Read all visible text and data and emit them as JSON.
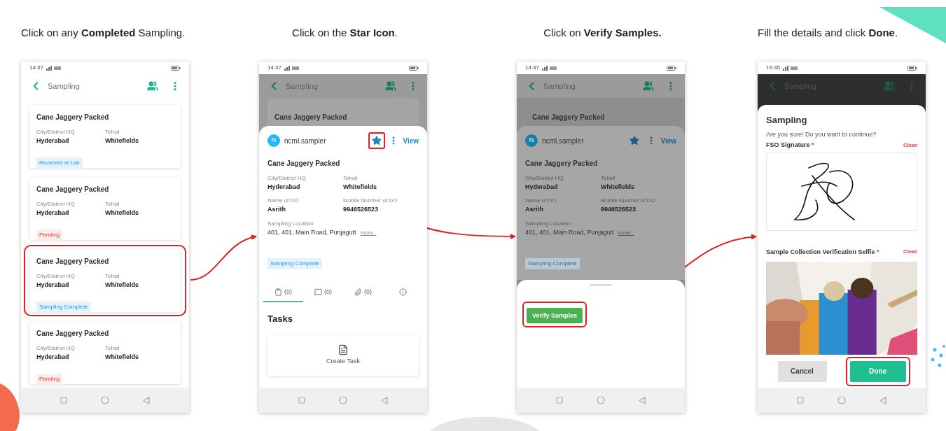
{
  "steps": [
    {
      "instruction": "Click on any **Completed** Sampling.",
      "screen": {
        "kind": "list",
        "time": "14:37",
        "app_title": "Sampling",
        "cards": [
          {
            "title": "Cane Jaggery Packed",
            "fields": [
              {
                "label": "City/District HQ",
                "value": "Hyderabad"
              },
              {
                "label": "Tehsil",
                "value": "Whitefields"
              }
            ],
            "status": {
              "text": "Received at Lab",
              "kind": "info"
            },
            "highlighted": false
          },
          {
            "title": "Cane Jaggery Packed",
            "fields": [
              {
                "label": "City/District HQ",
                "value": "Hyderabad"
              },
              {
                "label": "Tehsil",
                "value": "Whitefields"
              }
            ],
            "status": {
              "text": "Pending",
              "kind": "pending"
            },
            "highlighted": false
          },
          {
            "title": "Cane Jaggery Packed",
            "fields": [
              {
                "label": "City/District HQ",
                "value": "Hyderabad"
              },
              {
                "label": "Tehsil",
                "value": "Whitefields"
              }
            ],
            "status": {
              "text": "Sampling Complete",
              "kind": "info"
            },
            "highlighted": true
          },
          {
            "title": "Cane Jaggery Packed",
            "fields": [
              {
                "label": "City/District HQ",
                "value": "Hyderabad"
              },
              {
                "label": "Tehsil",
                "value": "Whitefields"
              }
            ],
            "status": {
              "text": "Pending",
              "kind": "pending"
            },
            "highlighted": false
          }
        ]
      }
    },
    {
      "instruction": "Click on the **Star Icon**.",
      "screen": {
        "kind": "detail",
        "time": "14:37",
        "app_title": "Sampling",
        "behind_title": "Cane Jaggery Packed",
        "dimmed": false,
        "user": {
          "initial": "N",
          "name": "ncml.sampler"
        },
        "star_highlighted": true,
        "view": "View",
        "title": "Cane Jaggery Packed",
        "fields": [
          {
            "label": "City/District HQ",
            "value": "Hyderabad"
          },
          {
            "label": "Tehsil",
            "value": "Whitefields"
          },
          {
            "label": "Name of DO",
            "value": "Asrith"
          },
          {
            "label": "Mobile Number of DO",
            "value": "9946526523"
          }
        ],
        "location": {
          "label": "Sampling Location",
          "value": "401, 401, Main Road, Punjagutt",
          "more": "more.."
        },
        "status": {
          "text": "Sampling Complete",
          "kind": "info"
        },
        "tabs": [
          {
            "kind": "tasks",
            "count": "(0)",
            "selected": true
          },
          {
            "kind": "comments",
            "count": "(0)",
            "selected": false
          },
          {
            "kind": "attachments",
            "count": "(0)",
            "selected": false
          },
          {
            "kind": "info",
            "selected": false
          }
        ],
        "section": "Tasks",
        "create": "Create Task"
      }
    },
    {
      "instruction": "Click on **Verify Samples.**",
      "screen": {
        "kind": "detail",
        "time": "14:37",
        "app_title": "Sampling",
        "behind_title": "Cane Jaggery Packed",
        "dimmed": true,
        "user": {
          "initial": "N",
          "name": "ncml.sampler"
        },
        "star_highlighted": false,
        "view": "View",
        "title": "Cane Jaggery Packed",
        "fields": [
          {
            "label": "City/District HQ",
            "value": "Hyderabad"
          },
          {
            "label": "Tehsil",
            "value": "Whitefields"
          },
          {
            "label": "Name of DO",
            "value": "Asrith"
          },
          {
            "label": "Mobile Number of DO",
            "value": "9946526523"
          }
        ],
        "location": {
          "label": "Sampling Location",
          "value": "401, 401, Main Road, Punjagutt",
          "more": "more.."
        },
        "status": {
          "text": "Sampling Complete",
          "kind": "info"
        },
        "sheet": {
          "button": "Verify Samples",
          "highlighted": true
        }
      }
    },
    {
      "instruction": "Fill the details and click **Done**.",
      "screen": {
        "kind": "confirm",
        "time": "19:35",
        "app_title": "Sampling",
        "dialog": {
          "title": "Sampling",
          "message": "Are you sure! Do you want to continue?",
          "signature": {
            "label": "FSO Signature",
            "required": "*",
            "clear": "Clear"
          },
          "selfie": {
            "label": "Sample Collection Verification Selfie",
            "required": "*",
            "clear": "Clear"
          },
          "buttons": [
            {
              "label": "Cancel",
              "kind": "secondary",
              "highlighted": false
            },
            {
              "label": "Done",
              "kind": "primary",
              "highlighted": true
            }
          ]
        }
      }
    }
  ]
}
